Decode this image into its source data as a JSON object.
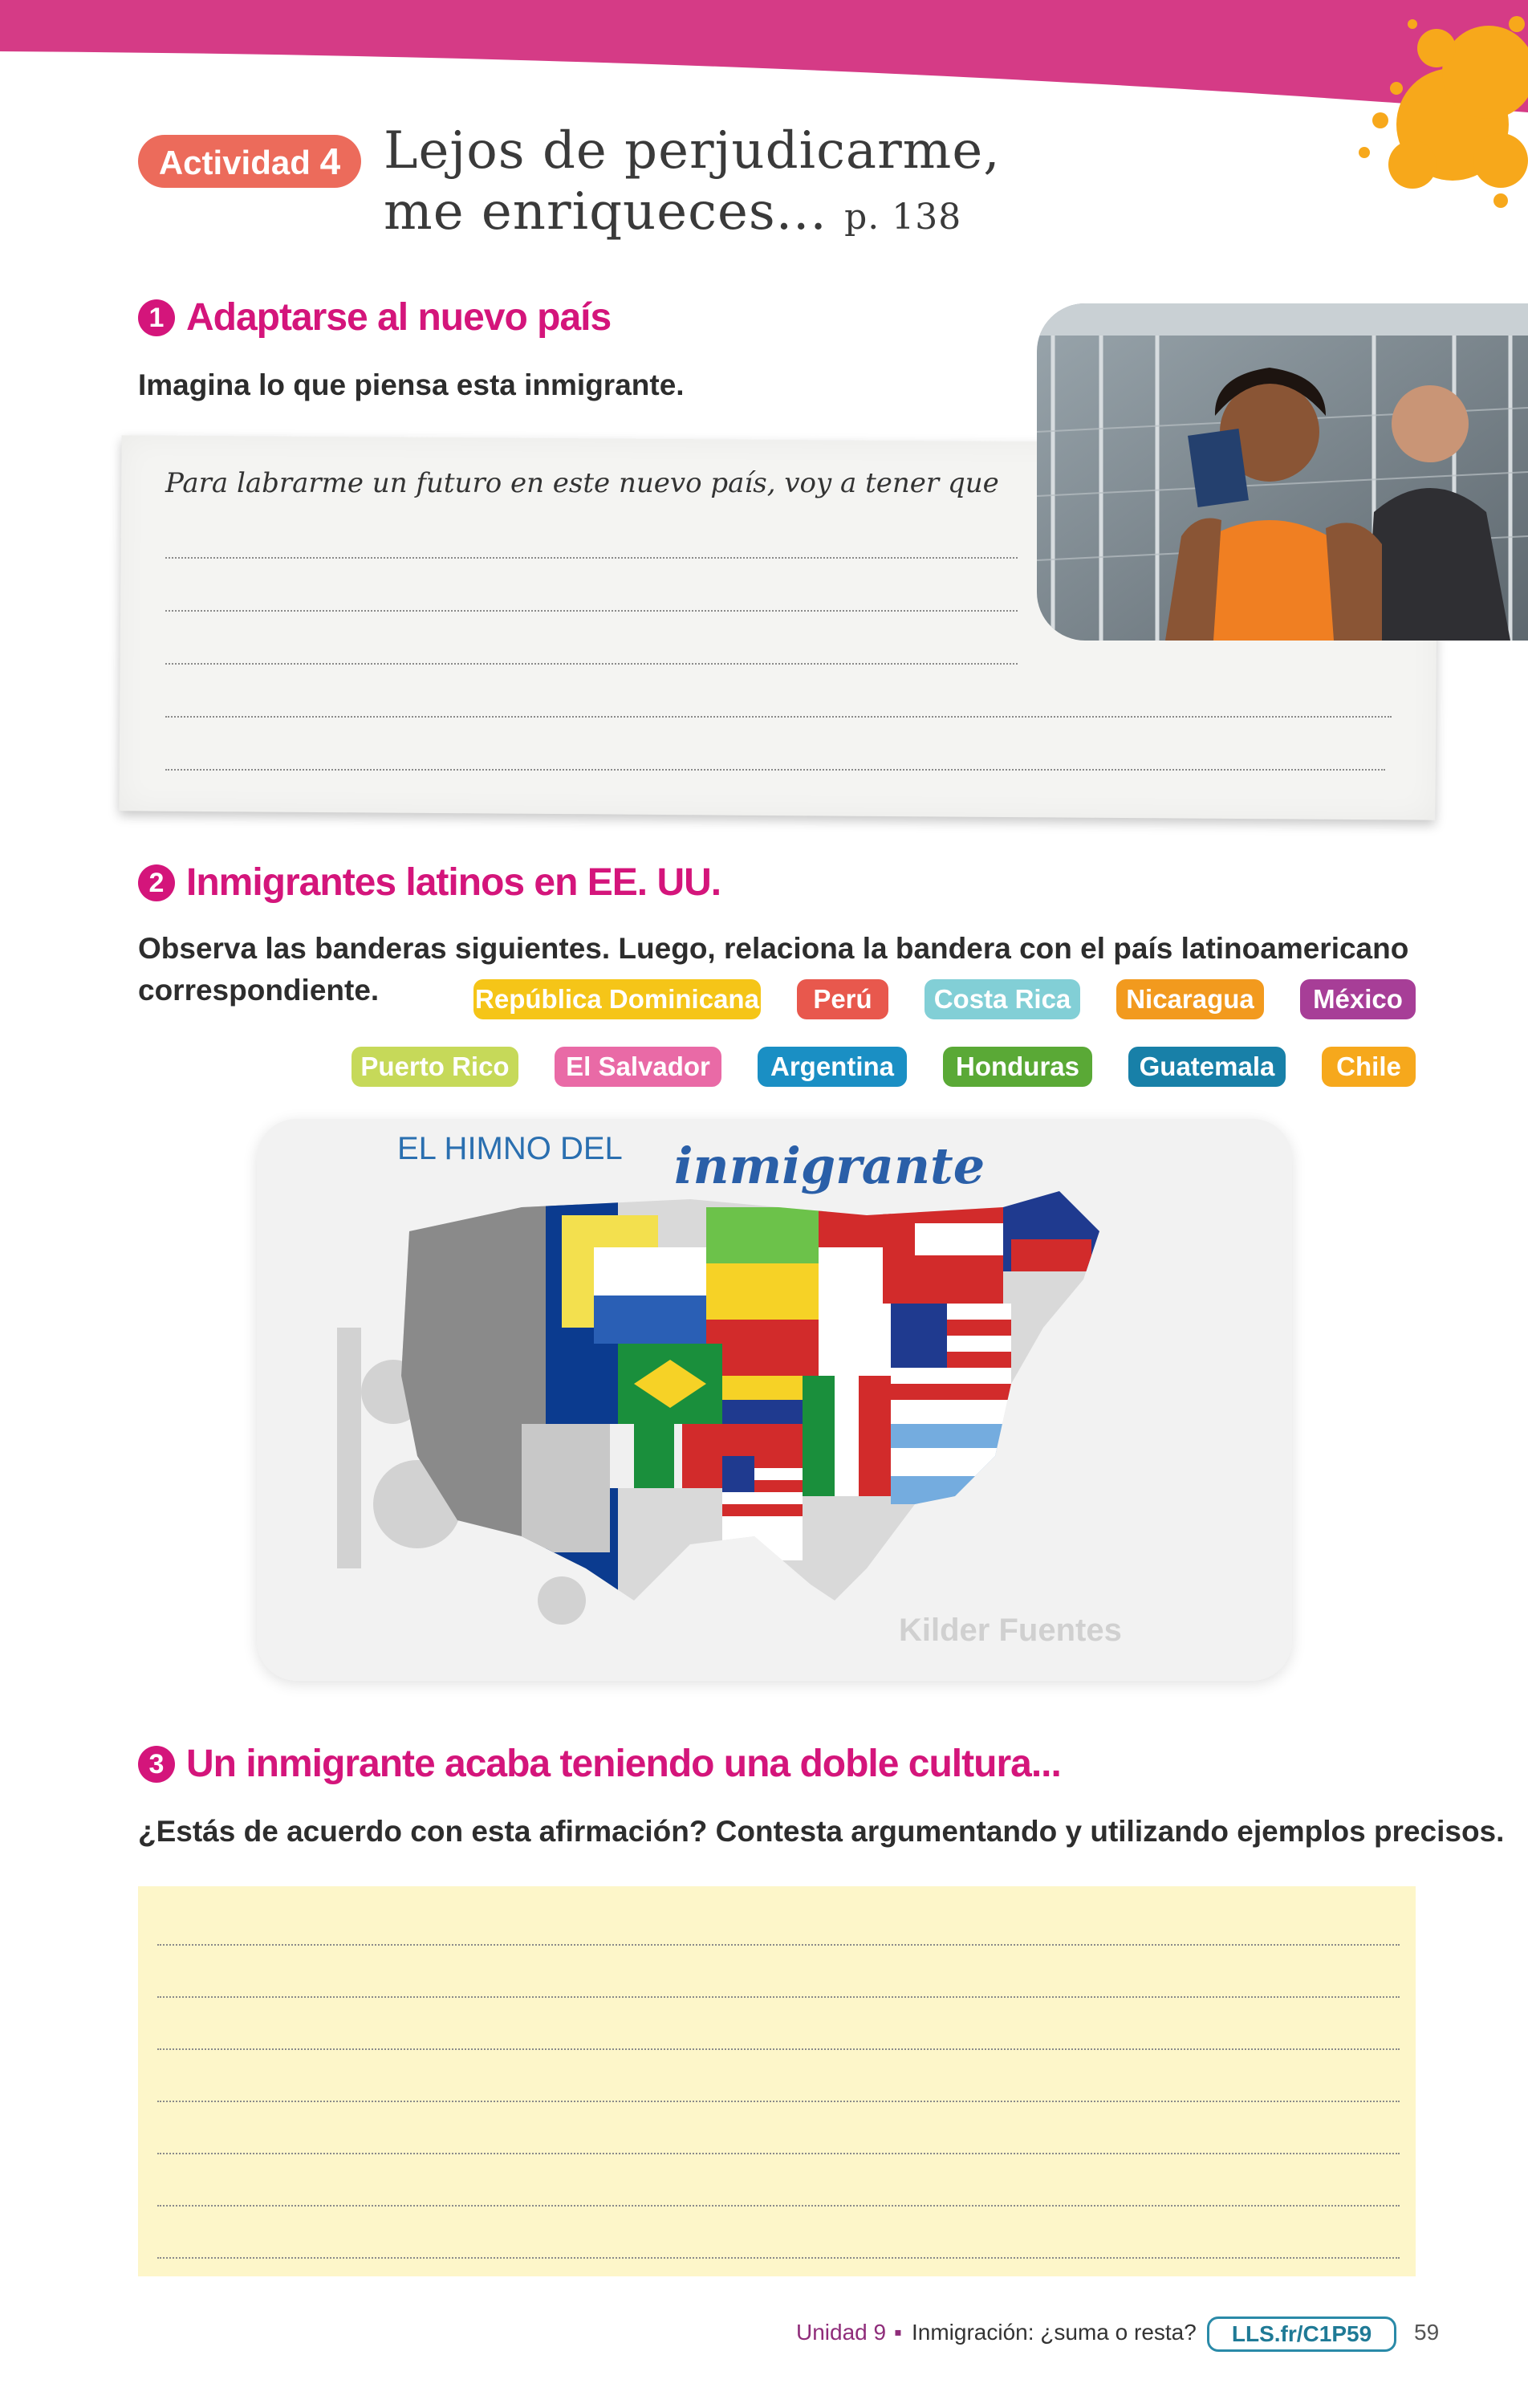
{
  "activity": {
    "badge_word": "Actividad",
    "badge_number": "4",
    "title_line1": "Lejos de perjudicarme,",
    "title_line2": "me enriqueces...",
    "page_ref": "p. 138"
  },
  "section1": {
    "number": "1",
    "title": "Adaptarse al nuevo país",
    "instruction": "Imagina lo que piensa esta inmigrante.",
    "prompt": "Para labrarme un futuro en este nuevo país, voy a tener que",
    "photo_alt": "Mujer inmigrante sonriendo con un pasaporte"
  },
  "section2": {
    "number": "2",
    "title": "Inmigrantes latinos en EE. UU.",
    "instruction_line1": "Observa las banderas siguientes. Luego, relaciona la bandera con el país latinoamericano",
    "instruction_line2": "correspondiente.",
    "tags": [
      {
        "label": "República Dominicana",
        "color": "#f5c518"
      },
      {
        "label": "Perú",
        "color": "#e8584d"
      },
      {
        "label": "Costa Rica",
        "color": "#82cfd6"
      },
      {
        "label": "Nicaragua",
        "color": "#f29a1e"
      },
      {
        "label": "México",
        "color": "#a73e97"
      },
      {
        "label": "Puerto Rico",
        "color": "#c6d959"
      },
      {
        "label": "El Salvador",
        "color": "#e96aa6"
      },
      {
        "label": "Argentina",
        "color": "#1a8fc4"
      },
      {
        "label": "Honduras",
        "color": "#5aa936"
      },
      {
        "label": "Guatemala",
        "color": "#1880a8"
      },
      {
        "label": "Chile",
        "color": "#f6a81c"
      }
    ],
    "poster": {
      "title_small": "EL HIMNO DEL",
      "title_script": "inmigrante",
      "artist": "Kilder Fuentes"
    }
  },
  "section3": {
    "number": "3",
    "title": "Un inmigrante acaba teniendo una doble cultura...",
    "instruction": "¿Estás de acuerdo con esta afirmación? Contesta argumentando y utilizando ejemplos precisos."
  },
  "footer": {
    "unit": "Unidad 9",
    "separator": "▪",
    "topic": "Inmigración: ¿suma o resta?",
    "code": "LLS.fr/C1P59",
    "page_number": "59"
  },
  "colors": {
    "brand_pink": "#d4157b",
    "band_pink": "#d53b86",
    "badge": "#ec6b5b",
    "answer_box": "#fdf6c9",
    "splash": "#f7a81b"
  }
}
